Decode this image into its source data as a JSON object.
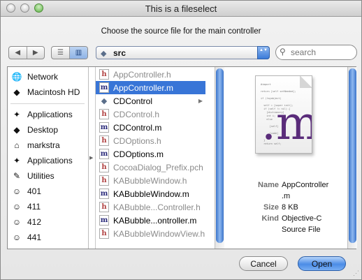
{
  "window": {
    "title": "This is a fileselect"
  },
  "prompt": "Choose the source file for the main controller",
  "nav": {
    "back_label": "◀",
    "forward_label": "▶"
  },
  "view": {
    "list_label": "☰",
    "column_label": "▥"
  },
  "location": {
    "label": "src",
    "arrows": "▲▼"
  },
  "search": {
    "placeholder": "search"
  },
  "sidebar": {
    "devices": [
      {
        "label": "Network",
        "icon": "network-globe-icon"
      },
      {
        "label": "Macintosh HD",
        "icon": "hard-disk-icon"
      }
    ],
    "places": [
      {
        "label": "Applications",
        "icon": "applications-icon"
      },
      {
        "label": "Desktop",
        "icon": "desktop-icon"
      },
      {
        "label": "markstra",
        "icon": "home-icon"
      },
      {
        "label": "Applications",
        "icon": "applications-icon"
      },
      {
        "label": "Utilities",
        "icon": "utilities-icon"
      },
      {
        "label": "401",
        "icon": "portrait-icon"
      },
      {
        "label": "411",
        "icon": "portrait-icon"
      },
      {
        "label": "412",
        "icon": "portrait-icon"
      },
      {
        "label": "441",
        "icon": "portrait-icon"
      }
    ]
  },
  "files": [
    {
      "name": "AppController.h",
      "type": "h",
      "enabled": false,
      "selected": false
    },
    {
      "name": "AppController.m",
      "type": "m",
      "enabled": true,
      "selected": true
    },
    {
      "name": "CDControl",
      "type": "folder",
      "enabled": true,
      "selected": false
    },
    {
      "name": "CDControl.h",
      "type": "h",
      "enabled": false,
      "selected": false
    },
    {
      "name": "CDControl.m",
      "type": "m",
      "enabled": true,
      "selected": false
    },
    {
      "name": "CDOptions.h",
      "type": "h",
      "enabled": false,
      "selected": false
    },
    {
      "name": "CDOptions.m",
      "type": "m",
      "enabled": true,
      "selected": false
    },
    {
      "name": "CocoaDialog_Prefix.pch",
      "type": "h",
      "enabled": false,
      "selected": false
    },
    {
      "name": "KABubbleWindow.h",
      "type": "h",
      "enabled": false,
      "selected": false
    },
    {
      "name": "KABubbleWindow.m",
      "type": "m",
      "enabled": true,
      "selected": false
    },
    {
      "name": "KABubble...Controller.h",
      "type": "h",
      "enabled": false,
      "selected": false
    },
    {
      "name": "KABubble...ontroller.m",
      "type": "m",
      "enabled": true,
      "selected": false
    },
    {
      "name": "KABubbleWindowView.h",
      "type": "h",
      "enabled": false,
      "selected": false
    }
  ],
  "preview": {
    "glyph": ".m",
    "info": [
      {
        "key": "Name",
        "value": "AppController"
      },
      {
        "key": "",
        "value": ".m"
      },
      {
        "key": "Size",
        "value": "8 KB"
      },
      {
        "key": "Kind",
        "value": "Objective-C"
      },
      {
        "key": "",
        "value": "Source File"
      }
    ]
  },
  "buttons": {
    "cancel": "Cancel",
    "open": "Open"
  },
  "colors": {
    "selection": "#3875d7",
    "accent": "#4b8ce6"
  }
}
